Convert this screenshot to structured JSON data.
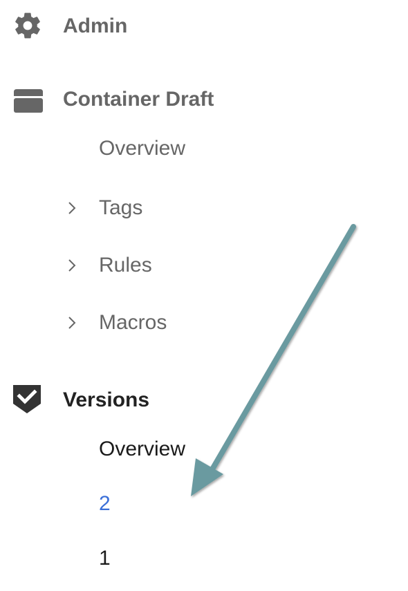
{
  "admin": {
    "label": "Admin",
    "icon": "gear-icon"
  },
  "container_draft": {
    "label": "Container Draft",
    "icon": "folder-icon",
    "items": [
      {
        "label": "Overview",
        "has_chevron": false
      },
      {
        "label": "Tags",
        "has_chevron": true
      },
      {
        "label": "Rules",
        "has_chevron": true
      },
      {
        "label": "Macros",
        "has_chevron": true
      }
    ]
  },
  "versions": {
    "label": "Versions",
    "icon": "shield-check-icon",
    "items": [
      {
        "label": "Overview"
      },
      {
        "label": "2"
      },
      {
        "label": "1"
      }
    ]
  },
  "colors": {
    "muted_text": "#666666",
    "dark_text": "#222222",
    "link_text": "#3a6fd8",
    "icon_gray": "#666666",
    "icon_dark": "#333333",
    "arrow": "#6b9aa0"
  }
}
